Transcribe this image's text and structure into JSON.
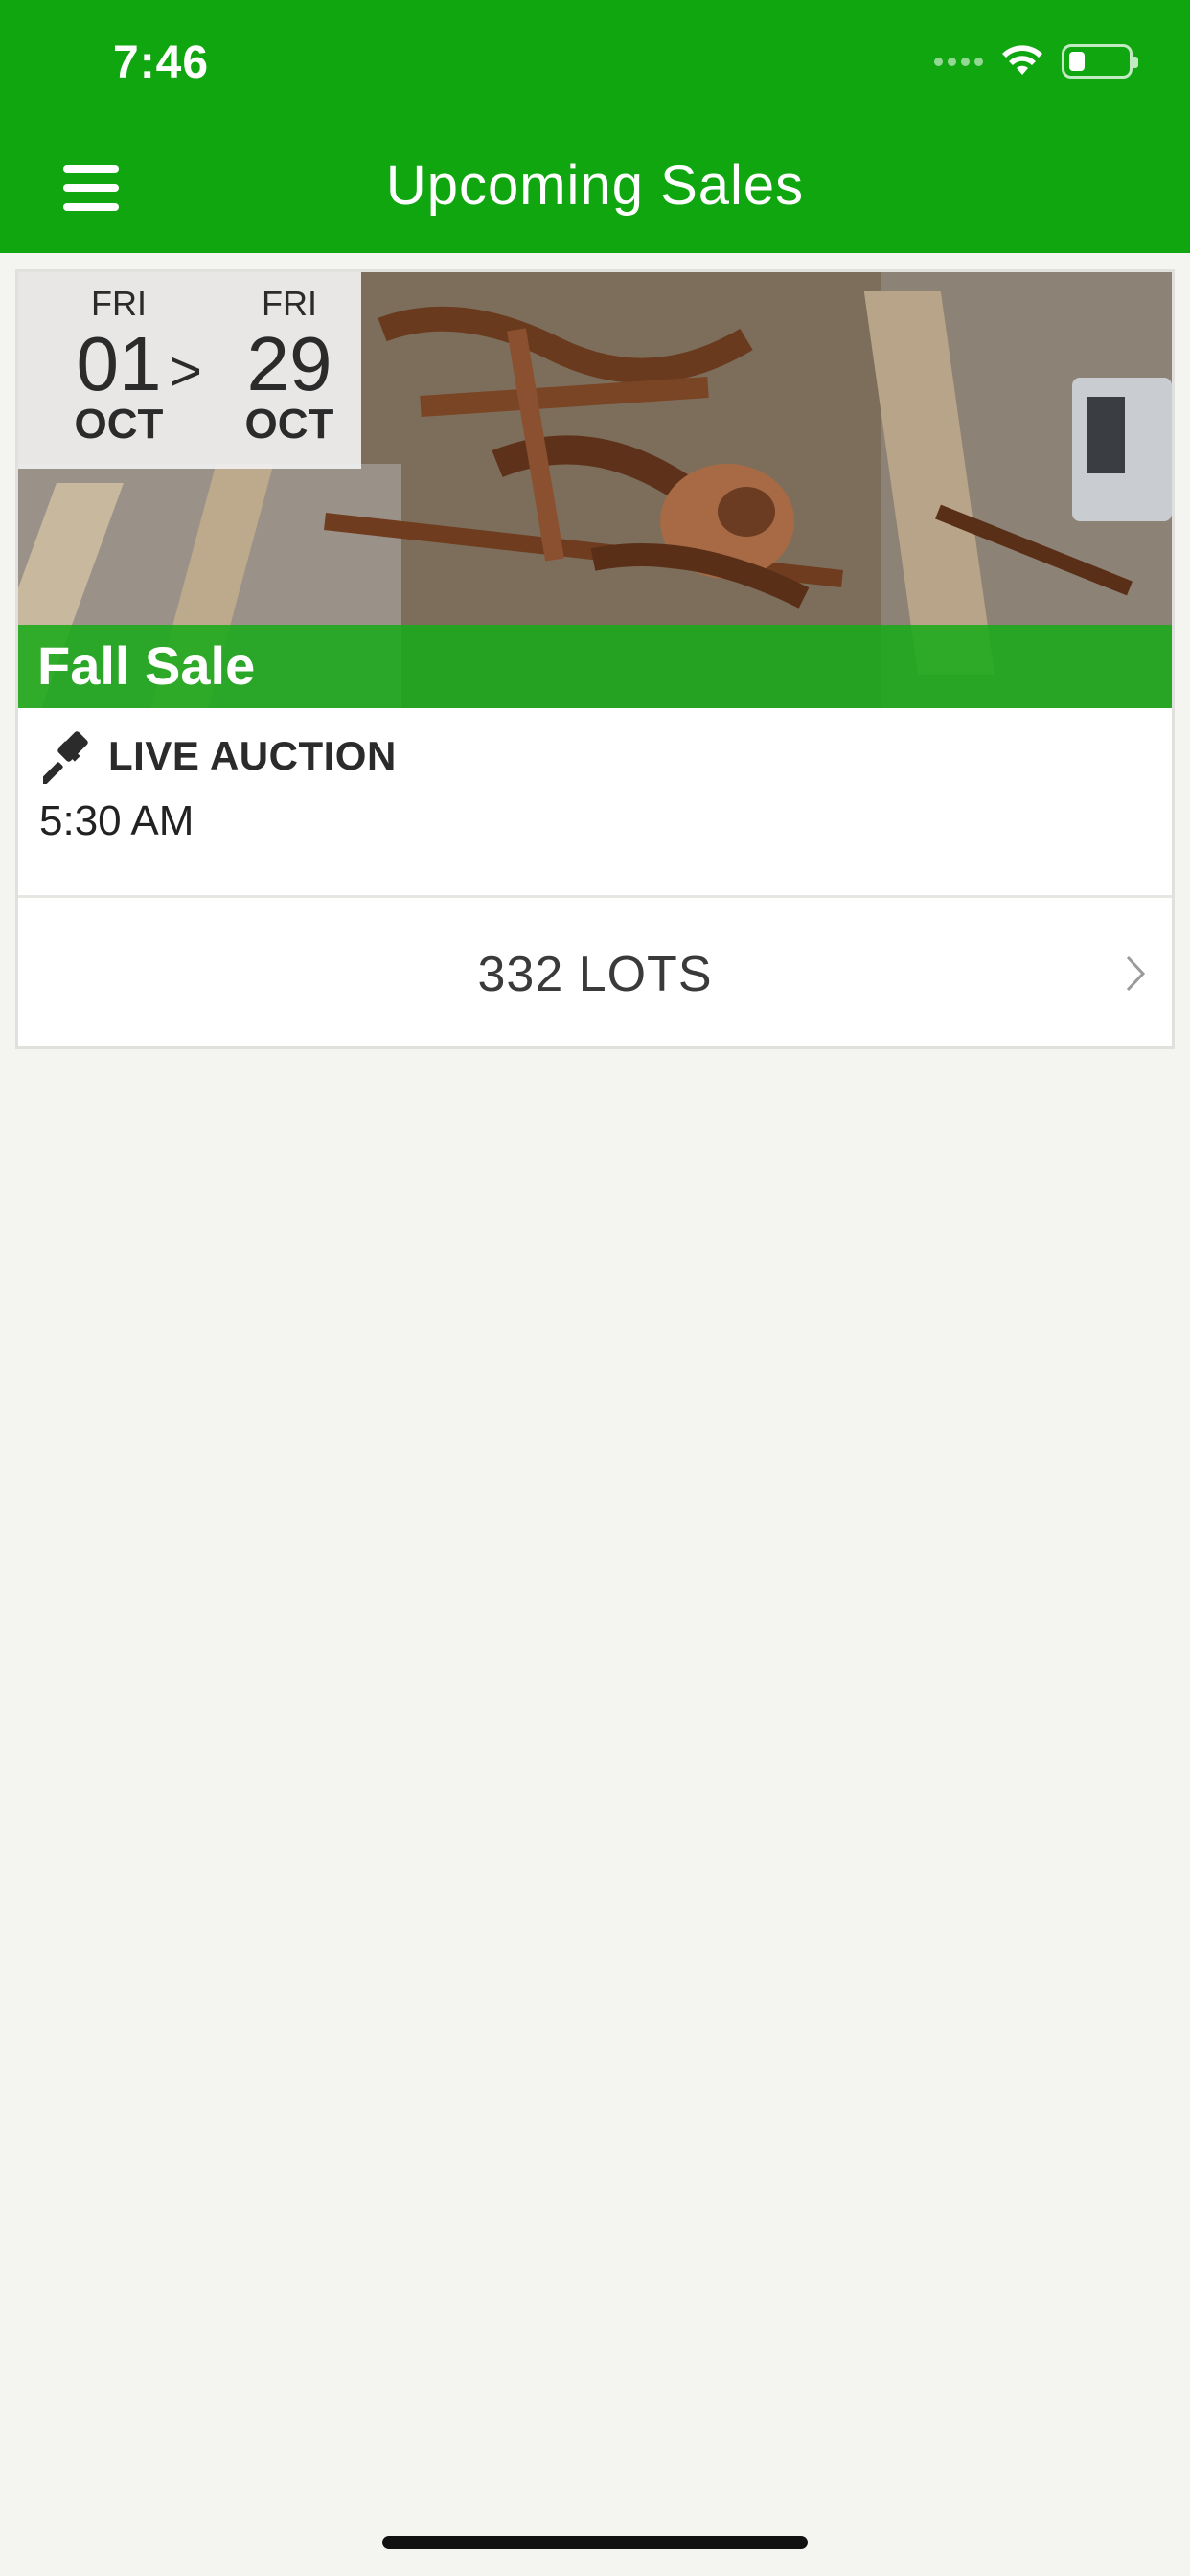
{
  "status_bar": {
    "time": "7:46"
  },
  "header": {
    "title": "Upcoming Sales",
    "menu_icon": "hamburger-menu-icon"
  },
  "sale": {
    "start": {
      "weekday": "FRI",
      "day": "01",
      "month": "OCT"
    },
    "arrow": ">",
    "end": {
      "weekday": "FRI",
      "day": "29",
      "month": "OCT"
    },
    "title": "Fall Sale",
    "auction_type": "LIVE AUCTION",
    "auction_icon": "gavel-icon",
    "time": "5:30 AM",
    "lots_label": "332 LOTS"
  },
  "colors": {
    "brand_green": "#0fa60f",
    "title_bar_green": "#1aaa1a",
    "background": "#f4f4f1"
  }
}
